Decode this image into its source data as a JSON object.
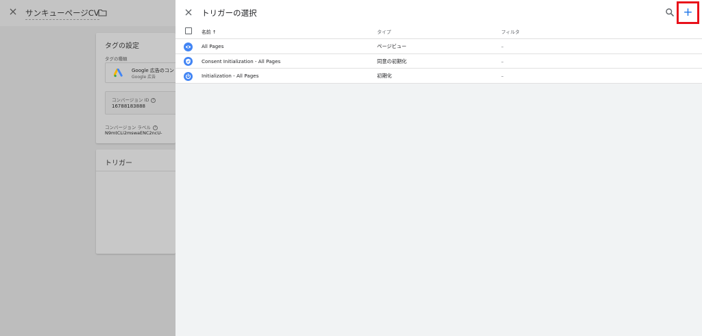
{
  "background_editor": {
    "title": "サンキューページCV",
    "tag_settings": {
      "title": "タグの設定",
      "tag_type_label": "タグの種類",
      "tag_type_name": "Google 広告のコン",
      "tag_type_sub": "Google 広告",
      "conversion_id_label": "コンバージョン ID",
      "conversion_id_value": "16788183888",
      "conversion_label_label": "コンバージョン ラベル",
      "conversion_label_value": "N9mtCLi2mswaENC2ncU-"
    },
    "trigger_card_title": "トリガー"
  },
  "panel": {
    "title": "トリガーの選択",
    "search_icon": "search-icon",
    "add_label": "+",
    "accent_color": "#1a73e8",
    "highlight_color": "#e8101a"
  },
  "table": {
    "columns": {
      "name": "名前 ↑",
      "type": "タイプ",
      "filter": "フィルタ"
    },
    "rows": [
      {
        "icon": "eye-icon",
        "name": "All Pages",
        "type": "ページビュー",
        "filter": "–"
      },
      {
        "icon": "consent-icon",
        "name": "Consent Initialization - All Pages",
        "type": "同意の初期化",
        "filter": "–"
      },
      {
        "icon": "power-icon",
        "name": "Initialization - All Pages",
        "type": "初期化",
        "filter": "–"
      }
    ]
  }
}
